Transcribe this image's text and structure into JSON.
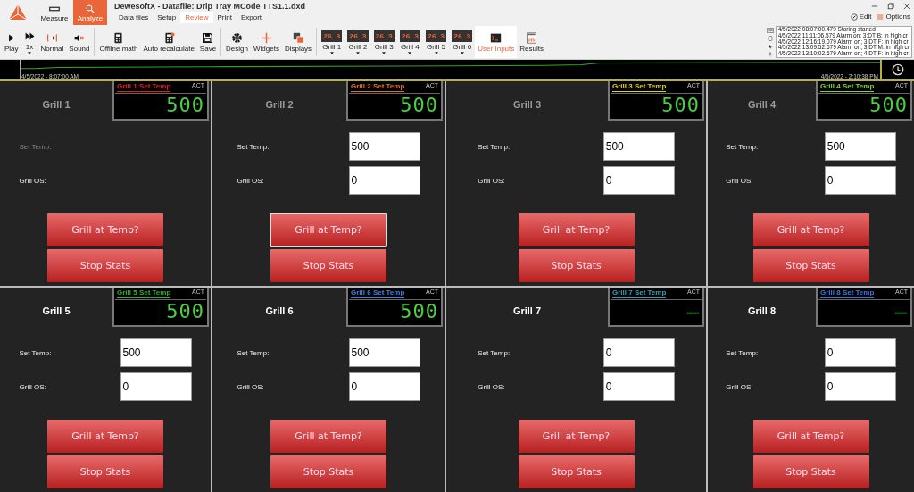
{
  "app": {
    "modes": [
      {
        "label": "Measure",
        "selected": false
      },
      {
        "label": "Analyze",
        "selected": true
      }
    ],
    "title": "DewesoftX - Datafile: Drip Tray MCode TTS1.1.dxd",
    "tabs": [
      {
        "label": "Data files",
        "selected": false
      },
      {
        "label": "Setup",
        "selected": false
      },
      {
        "label": "Review",
        "selected": true
      },
      {
        "label": "Print",
        "selected": false
      },
      {
        "label": "Export",
        "selected": false
      }
    ],
    "edit_label": "Edit",
    "options_label": "Options"
  },
  "toolbar": [
    {
      "kind": "play",
      "label": "Play",
      "selected": false
    },
    {
      "kind": "speed",
      "label": "1x",
      "selected": false
    },
    {
      "kind": "normal",
      "label": "Normal",
      "selected": false
    },
    {
      "kind": "sound",
      "label": "Sound",
      "selected": false
    },
    {
      "kind": "math",
      "label": "Offline math",
      "selected": false
    },
    {
      "kind": "recalc",
      "label": "Auto recalculate",
      "selected": false
    },
    {
      "kind": "save",
      "label": "Save",
      "selected": false
    },
    {
      "kind": "design",
      "label": "Design",
      "selected": false
    },
    {
      "kind": "widgets",
      "label": "Widgets",
      "selected": false
    },
    {
      "kind": "displays",
      "label": "Displays",
      "selected": false
    },
    {
      "kind": "screen",
      "label": "Grill 1",
      "icon_text": "26.3",
      "selected": false
    },
    {
      "kind": "screen",
      "label": "Grill 2",
      "icon_text": "26.3",
      "selected": false
    },
    {
      "kind": "screen",
      "label": "Grill 3",
      "icon_text": "26.3",
      "selected": false
    },
    {
      "kind": "screen",
      "label": "Grill 4",
      "icon_text": "26.3",
      "selected": false
    },
    {
      "kind": "screen",
      "label": "Grill 5",
      "icon_text": "26.3",
      "selected": false
    },
    {
      "kind": "screen",
      "label": "Grill 6",
      "icon_text": "26.3",
      "selected": false
    },
    {
      "kind": "console",
      "label": "User Inputs",
      "selected": true
    },
    {
      "kind": "results",
      "label": "Results",
      "selected": false
    }
  ],
  "event_log": [
    "4/5/2022 08:07:00.479 Storing started",
    "4/5/2022 11:11:06.579 Alarm on; 3:DT B: in high cr",
    "4/5/2022 12:16:19.079 Alarm on; 3:DT F: in high cr",
    "4/5/2022 13:09:52.679 Alarm on; 3:DT M: in high cr",
    "4/5/2022 13:10:02.679 Alarm on; 4:DT F: in high cr"
  ],
  "overview": {
    "start_time": "4/5/2022 - 8:07:00 AM",
    "end_time": "4/5/2022 - 2:10:38 PM"
  },
  "panels": [
    {
      "title": "Grill 1",
      "dimmed": true,
      "display": {
        "label": "Grill 1 Set Temp",
        "color": "#e02020",
        "tag": "ACT",
        "value": "500"
      },
      "set_temp_label": "Set Temp:",
      "os_label": "Grill OS:",
      "at_temp_button": "Grill at Temp?",
      "focused": false,
      "stop_button": "Stop Stats"
    },
    {
      "title": "Grill 2",
      "dimmed": true,
      "display": {
        "label": "Grill 2 Set Temp",
        "color": "#e0702a",
        "tag": "ACT",
        "value": "500"
      },
      "set_temp_label": "Set Temp:",
      "set_temp": "500",
      "os_label": "Grill OS:",
      "os": "0",
      "at_temp_button": "Grill at Temp?",
      "focused": true,
      "stop_button": "Stop Stats"
    },
    {
      "title": "Grill 3",
      "dimmed": true,
      "display": {
        "label": "Grill 3 Set Temp",
        "color": "#e0d020",
        "tag": "ACT",
        "value": "500"
      },
      "set_temp_label": "Set Temp:",
      "set_temp": "500",
      "os_label": "Grill OS:",
      "os": "0",
      "at_temp_button": "Grill at Temp?",
      "focused": false,
      "stop_button": "Stop Stats"
    },
    {
      "title": "Grill 4",
      "dimmed": true,
      "display": {
        "label": "Grill 4 Set Temp",
        "color": "#80d040",
        "tag": "ACT",
        "value": "500"
      },
      "set_temp_label": "Set Temp:",
      "set_temp": "500",
      "os_label": "Grill OS:",
      "os": "0",
      "at_temp_button": "Grill at Temp?",
      "focused": false,
      "stop_button": "Stop Stats"
    },
    {
      "title": "Grill 5",
      "dimmed": false,
      "display": {
        "label": "Grill 5 Set Temp",
        "color": "#30b030",
        "tag": "ACT",
        "value": "500"
      },
      "set_temp_label": "Set Temp:",
      "set_temp": "500",
      "os_label": "Grill OS:",
      "os": "0",
      "at_temp_button": "Grill at Temp?",
      "focused": false,
      "stop_button": "Stop Stats"
    },
    {
      "title": "Grill 6",
      "dimmed": false,
      "display": {
        "label": "Grill 6 Set Temp",
        "color": "#4080e0",
        "tag": "ACT",
        "value": "500"
      },
      "set_temp_label": "Set Temp:",
      "set_temp": "500",
      "os_label": "Grill OS:",
      "os": "0",
      "at_temp_button": "Grill at Temp?",
      "focused": false,
      "stop_button": "Stop Stats"
    },
    {
      "title": "Grill 7",
      "dimmed": false,
      "display": {
        "label": "Grill 7 Set Temp",
        "color": "#30a0b8",
        "tag": "ACT",
        "value": "—"
      },
      "set_temp_label": "Set Temp:",
      "set_temp": "0",
      "os_label": "Grill OS:",
      "os": "0",
      "at_temp_button": "Grill at Temp?",
      "focused": false,
      "stop_button": "Stop Stats"
    },
    {
      "title": "Grill 8",
      "dimmed": false,
      "display": {
        "label": "Grill 8 Set Temp",
        "color": "#3a78e0",
        "tag": "ACT",
        "value": "—"
      },
      "set_temp_label": "Set Temp:",
      "set_temp": "0",
      "os_label": "Grill OS:",
      "os": "0",
      "at_temp_button": "Grill at Temp?",
      "focused": false,
      "stop_button": "Stop Stats"
    }
  ]
}
